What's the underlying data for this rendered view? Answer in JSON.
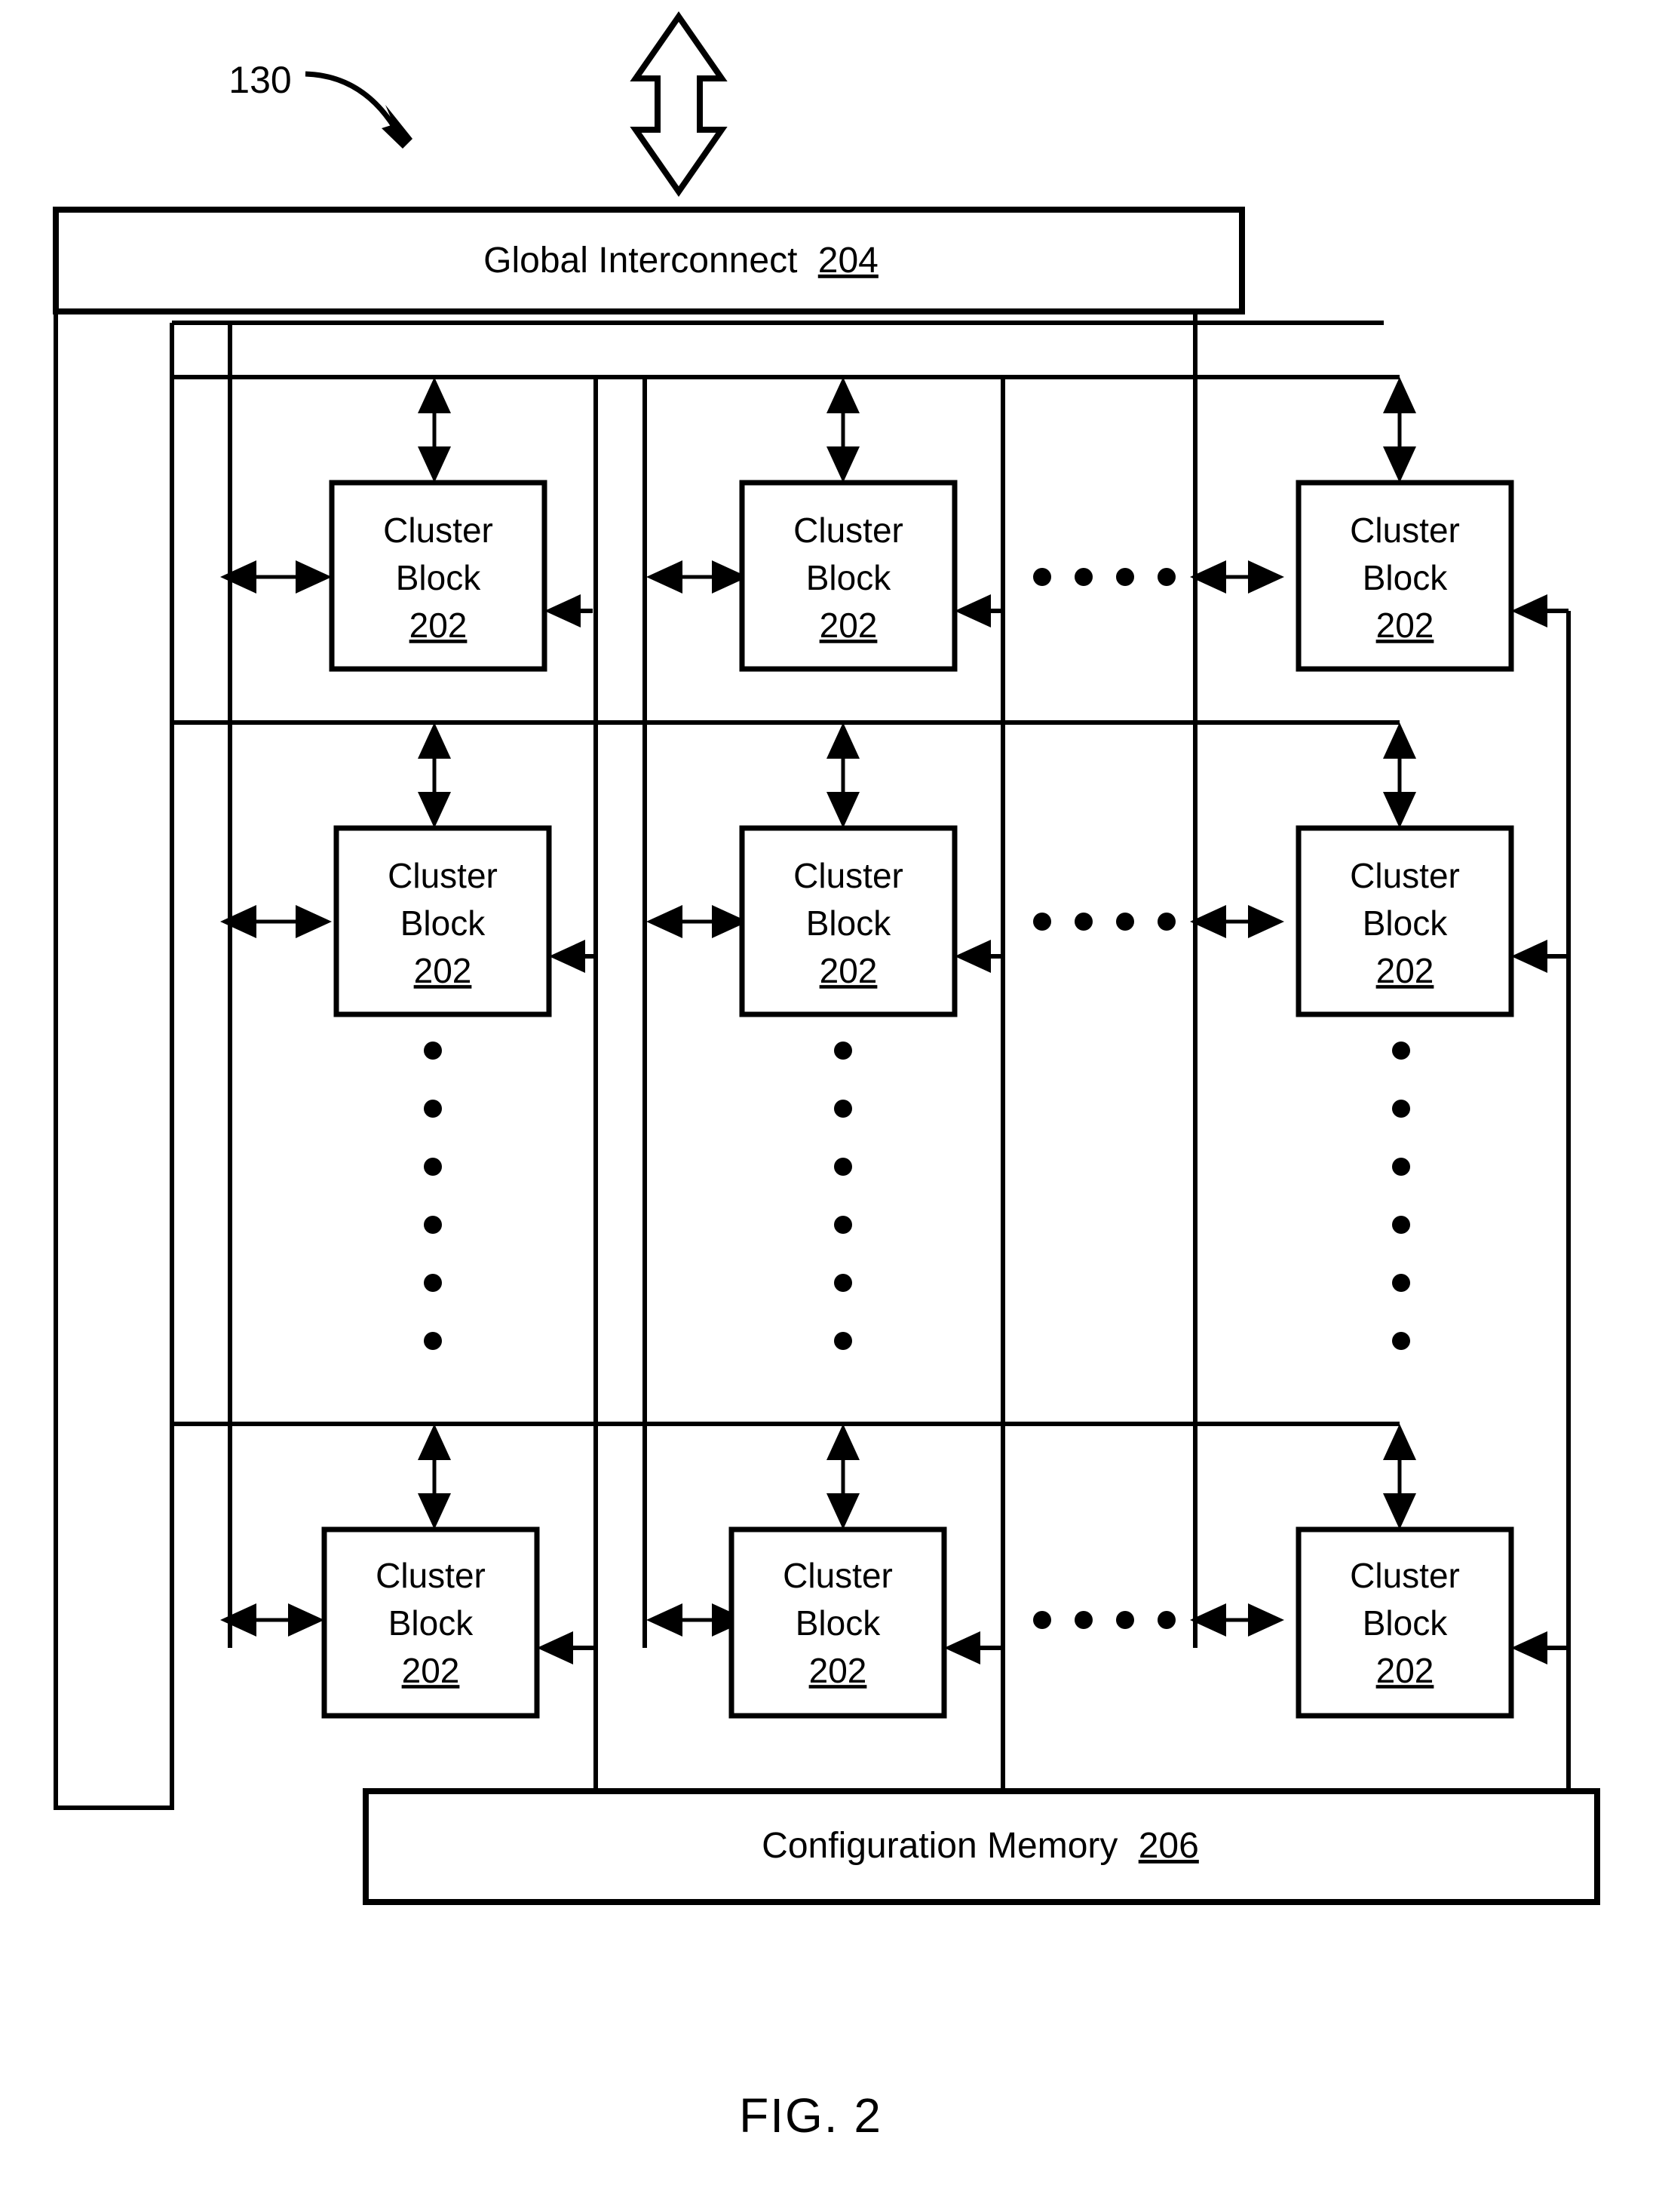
{
  "figure": {
    "caption": "FIG. 2",
    "reference_numeral": "130"
  },
  "blocks": {
    "global_interconnect": {
      "label": "Global Interconnect",
      "ref": "204"
    },
    "configuration_memory": {
      "label": "Configuration Memory",
      "ref": "206"
    },
    "cluster": {
      "line1": "Cluster",
      "line2": "Block",
      "ref": "202"
    }
  },
  "grid": {
    "rows": 3,
    "cols": 3,
    "row_ellipsis_dots": 6,
    "col_ellipsis_dots": 4,
    "cells": [
      [
        {
          "line1": "Cluster",
          "line2": "Block",
          "ref": "202"
        },
        {
          "line1": "Cluster",
          "line2": "Block",
          "ref": "202"
        },
        {
          "line1": "Cluster",
          "line2": "Block",
          "ref": "202"
        }
      ],
      [
        {
          "line1": "Cluster",
          "line2": "Block",
          "ref": "202"
        },
        {
          "line1": "Cluster",
          "line2": "Block",
          "ref": "202"
        },
        {
          "line1": "Cluster",
          "line2": "Block",
          "ref": "202"
        }
      ],
      [
        {
          "line1": "Cluster",
          "line2": "Block",
          "ref": "202"
        },
        {
          "line1": "Cluster",
          "line2": "Block",
          "ref": "202"
        },
        {
          "line1": "Cluster",
          "line2": "Block",
          "ref": "202"
        }
      ]
    ]
  },
  "colors": {
    "ink": "#000000",
    "paper": "#ffffff"
  }
}
